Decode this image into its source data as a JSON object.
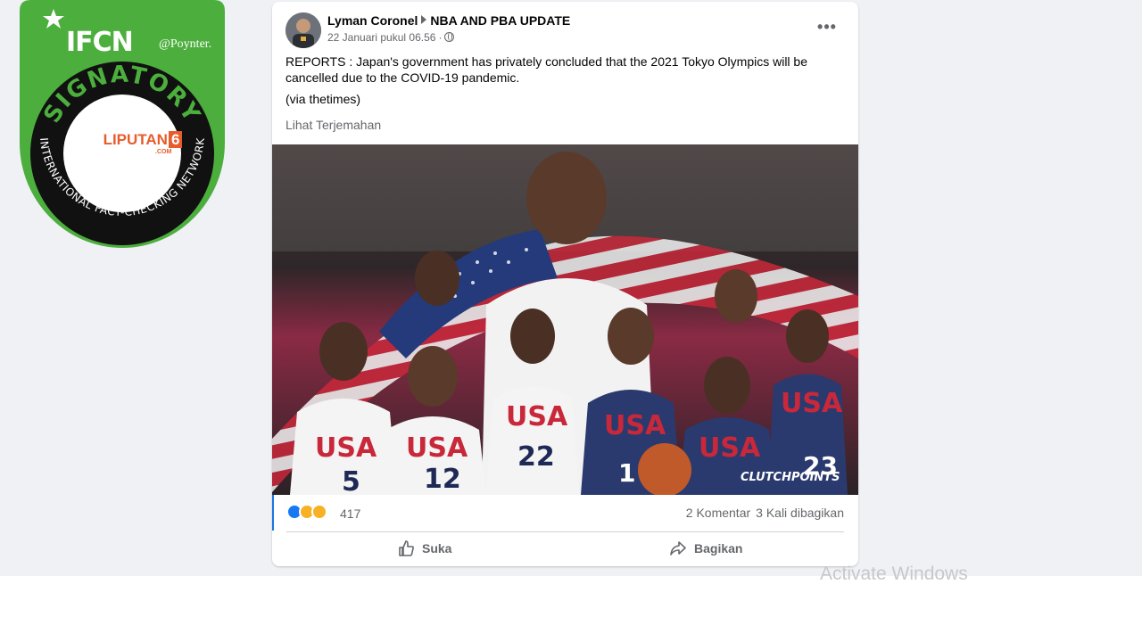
{
  "badge": {
    "wordmark": "IFCN",
    "poynter": "@Poynter.",
    "arc_top": "SIGNATORY",
    "arc_bottom": "INTERNATIONAL FACT-CHECKING NETWORK",
    "logo_text": "LIPUTAN",
    "logo_number": "6",
    "logo_sub": ".COM",
    "colors": {
      "green": "#4caf3d",
      "dark": "#111111",
      "orange": "#e85c2b"
    }
  },
  "post": {
    "author": "Lyman Coronel",
    "group": "NBA AND PBA UPDATE",
    "timestamp": "22 Januari pukul 06.56",
    "privacy_icon": "globe-icon",
    "more_label": "•••",
    "text": "REPORTS : Japan's government has privately concluded that the 2021 Tokyo Olympics will be cancelled due to the COVID-19 pandemic.",
    "via": "(via thetimes)",
    "translate": "Lihat Terjemahan",
    "image_watermark": "CLUTCHPOINTS",
    "jersey_numbers": [
      "5",
      "12",
      "22",
      "1",
      "23"
    ],
    "jersey_text": "USA"
  },
  "stats": {
    "reaction_icons": [
      "like-reaction-icon",
      "sad-reaction-icon",
      "wow-reaction-icon"
    ],
    "reaction_count": "417",
    "comments": "2 Komentar",
    "shares": "3 Kali dibagikan"
  },
  "actions": {
    "like_label": "Suka",
    "share_label": "Bagikan"
  },
  "os_watermark": "Activate Windows",
  "colors": {
    "canvas": "#eff1f4",
    "card": "#ffffff",
    "facebook_blue": "#1877f2",
    "muted_text": "#65676b"
  }
}
